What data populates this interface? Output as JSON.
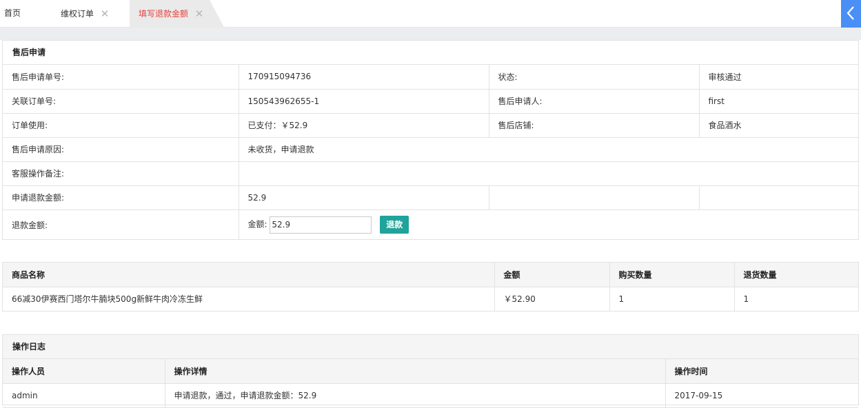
{
  "tabs": {
    "home": "首页",
    "orders": "维权订单",
    "current": "填写退款金额",
    "close_glyph": "✕"
  },
  "colors": {
    "active_tab_text": "#e8403c",
    "refund_button": "#1fa39a",
    "collapse_button": "#4a8ff5"
  },
  "info": {
    "title": "售后申请",
    "rows": [
      {
        "label1": "售后申请单号:",
        "value1": "170915094736",
        "label2": "状态:",
        "value2": "审核通过"
      },
      {
        "label1": "关联订单号:",
        "value1": "150543962655-1",
        "label2": "售后申请人:",
        "value2": "first"
      },
      {
        "label1": "订单使用:",
        "value1": "已支付：￥52.9",
        "label2": "售后店铺:",
        "value2": "食品酒水"
      }
    ],
    "reason_label": "售后申请原因:",
    "reason_value": "未收货，申请退款",
    "remark_label": "客服操作备注:",
    "remark_value": "",
    "apply_amount_label": "申请退款金额:",
    "apply_amount_value": "52.9",
    "refund_label": "退款金额:",
    "amount_prefix": "金额:",
    "amount_input_value": "52.9",
    "refund_button": "退款"
  },
  "goods": {
    "headers": [
      "商品名称",
      "金额",
      "购买数量",
      "退货数量"
    ],
    "rows": [
      {
        "name": "66减30伊赛西门塔尔牛腩块500g新鲜牛肉冷冻生鲜",
        "amount": "￥52.90",
        "bought": "1",
        "returned": "1"
      }
    ]
  },
  "log": {
    "title": "操作日志",
    "headers": [
      "操作人员",
      "操作详情",
      "操作时间"
    ],
    "rows": [
      {
        "operator": "admin",
        "detail": "申请退款，通过，申请退款金额：52.9",
        "time": "2017-09-15"
      }
    ]
  }
}
